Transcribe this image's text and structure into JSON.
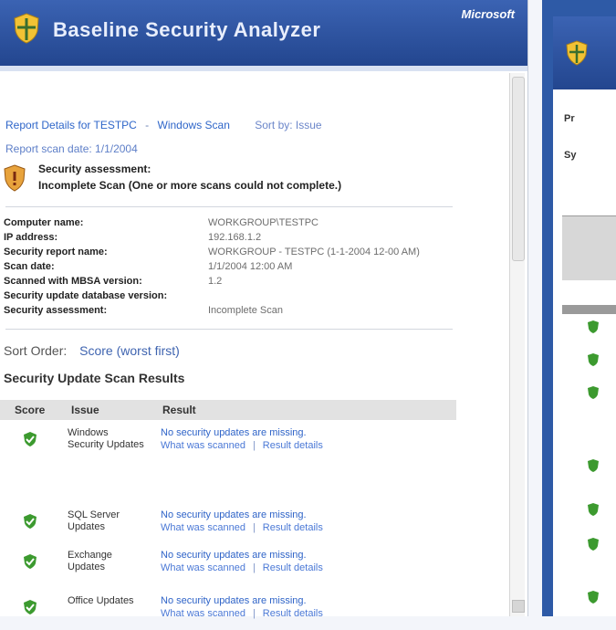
{
  "window": {
    "title": "Baseline Security Analyzer",
    "brand": "Microsoft"
  },
  "crumbs": {
    "items": [
      "Report Details for TESTPC",
      "Windows Scan"
    ],
    "right_link": "Sort by: Issue",
    "meta": "Report scan date: 1/1/2004"
  },
  "notice": {
    "title": "Security assessment:",
    "text": "Incomplete Scan (One or more scans could not complete.)"
  },
  "info": [
    {
      "key": "Computer name:",
      "value": "WORKGROUP\\TESTPC"
    },
    {
      "key": "IP address:",
      "value": "192.168.1.2"
    },
    {
      "key": "Security report name:",
      "value": "WORKGROUP - TESTPC (1-1-2004 12-00 AM)"
    },
    {
      "key": "Scan date:",
      "value": "1/1/2004 12:00 AM"
    },
    {
      "key": "Scanned with MBSA version:",
      "value": "1.2"
    },
    {
      "key": "Security update database version:",
      "value": ""
    },
    {
      "key": "Security assessment:",
      "value": "Incomplete Scan"
    }
  ],
  "sort": {
    "label": "Sort Order:",
    "value": "Score (worst first)"
  },
  "section_title": "Security Update Scan Results",
  "table": {
    "headers": [
      "Score",
      "Issue",
      "Result"
    ],
    "rows": [
      {
        "status": "pass",
        "issue": "Windows Security Updates",
        "result": "No security updates are missing.",
        "links": [
          "What was scanned",
          "Result details"
        ]
      },
      {
        "status": "pass",
        "issue": "SQL Server Updates",
        "result": "No security updates are missing.",
        "links": [
          "What was scanned",
          "Result details"
        ]
      },
      {
        "status": "pass",
        "issue": "Exchange Updates",
        "result": "No security updates are missing.",
        "links": [
          "What was scanned",
          "Result details"
        ]
      },
      {
        "status": "pass",
        "issue": "Office Updates",
        "result": "No security updates are missing.",
        "links": [
          "What was scanned",
          "Result details"
        ]
      }
    ]
  },
  "right_window": {
    "lines": [
      "Pr",
      "Sy"
    ]
  },
  "colors": {
    "accent": "#2f64c8",
    "titlebar": "#2e5aa6",
    "pass": "#3c9a2f",
    "warn": "#e8a33c"
  }
}
